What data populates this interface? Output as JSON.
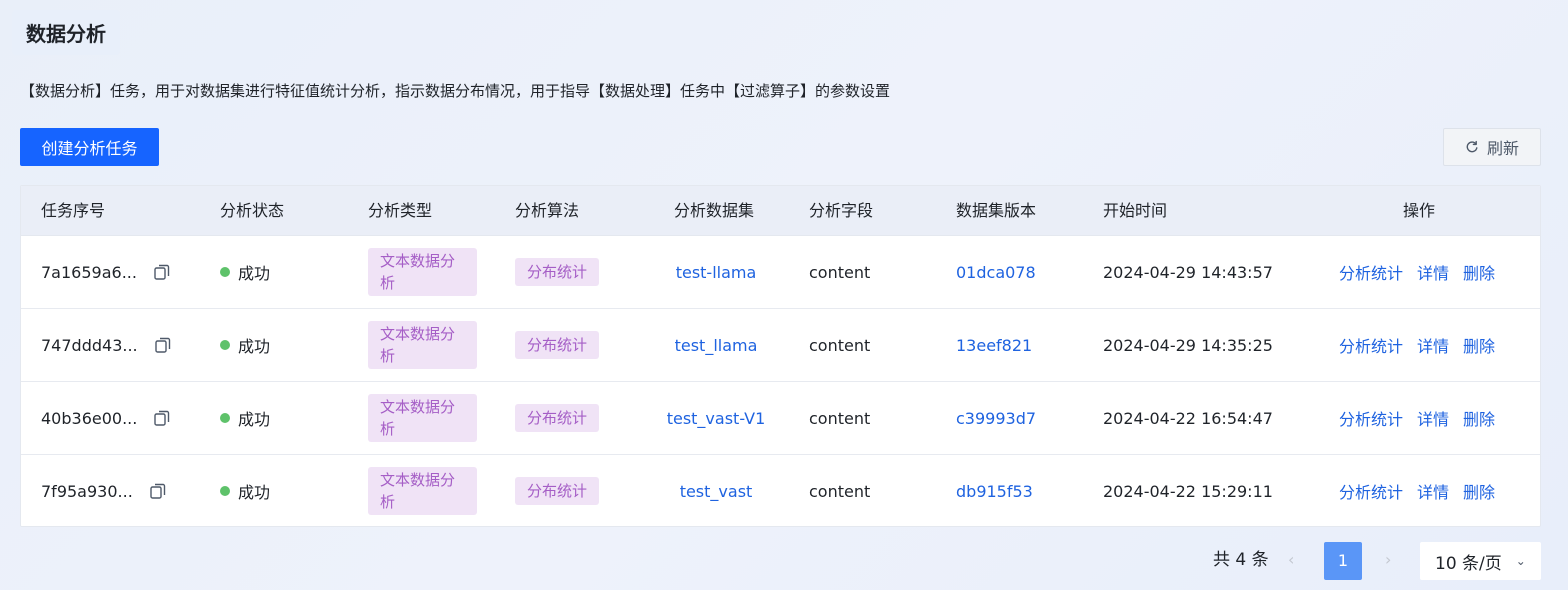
{
  "page": {
    "title": "数据分析",
    "description": "【数据分析】任务，用于对数据集进行特征值统计分析，指示数据分布情况，用于指导【数据处理】任务中【过滤算子】的参数设置"
  },
  "toolbar": {
    "create_label": "创建分析任务",
    "refresh_label": "刷新"
  },
  "table": {
    "columns": [
      "任务序号",
      "分析状态",
      "分析类型",
      "分析算法",
      "分析数据集",
      "分析字段",
      "数据集版本",
      "开始时间",
      "操作"
    ],
    "rows": [
      {
        "id": "7a1659a6...",
        "status": "成功",
        "type": "文本数据分析",
        "algo": "分布统计",
        "dataset": "test-llama",
        "field": "content",
        "version": "01dca078",
        "start": "2024-04-29 14:43:57"
      },
      {
        "id": "747ddd43...",
        "status": "成功",
        "type": "文本数据分析",
        "algo": "分布统计",
        "dataset": "test_llama",
        "field": "content",
        "version": "13eef821",
        "start": "2024-04-29 14:35:25"
      },
      {
        "id": "40b36e00...",
        "status": "成功",
        "type": "文本数据分析",
        "algo": "分布统计",
        "dataset": "test_vast-V1",
        "field": "content",
        "version": "c39993d7",
        "start": "2024-04-22 16:54:47"
      },
      {
        "id": "7f95a930...",
        "status": "成功",
        "type": "文本数据分析",
        "algo": "分布统计",
        "dataset": "test_vast",
        "field": "content",
        "version": "db915f53",
        "start": "2024-04-22 15:29:11"
      }
    ],
    "actions": {
      "stats": "分析统计",
      "detail": "详情",
      "delete": "删除"
    }
  },
  "pagination": {
    "total": "共 4 条",
    "prev": "‹",
    "current": "1",
    "next": "›",
    "page_size": "10 条/页"
  },
  "colors": {
    "primary": "#1664ff",
    "link": "#1f63e0",
    "success": "#5ec26a",
    "tag_bg": "#f0e3f6",
    "tag_text": "#a55ec6"
  }
}
